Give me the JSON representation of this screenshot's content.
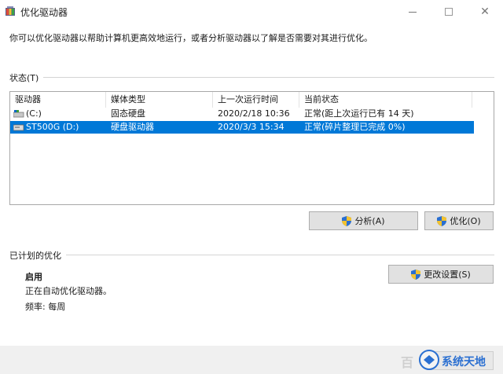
{
  "window": {
    "title": "优化驱动器",
    "description": "你可以优化驱动器以帮助计算机更高效地运行，或者分析驱动器以了解是否需要对其进行优化。"
  },
  "status": {
    "label": "状态(T)",
    "columns": [
      "驱动器",
      "媒体类型",
      "上一次运行时间",
      "当前状态"
    ],
    "drives": [
      {
        "name": "(C:)",
        "media": "固态硬盘",
        "last_run": "2020/2/18 10:36",
        "status": "正常(距上次运行已有 14 天)"
      },
      {
        "name": "ST500G (D:)",
        "media": "硬盘驱动器",
        "last_run": "2020/3/3 15:34",
        "status": "正常(碎片整理已完成 0%)"
      }
    ]
  },
  "buttons": {
    "analyze": "分析(A)",
    "optimize": "优化(O)",
    "change_settings": "更改设置(S)"
  },
  "scheduled": {
    "label": "已计划的优化",
    "state": "启用",
    "running_text": "正在自动优化驱动器。",
    "frequency": "频率: 每周"
  },
  "watermark": {
    "left": "百",
    "right": "系统天地"
  },
  "colors": {
    "selection": "#0078d7",
    "button_bg": "#e1e1e1",
    "border": "#a8a8a8"
  }
}
